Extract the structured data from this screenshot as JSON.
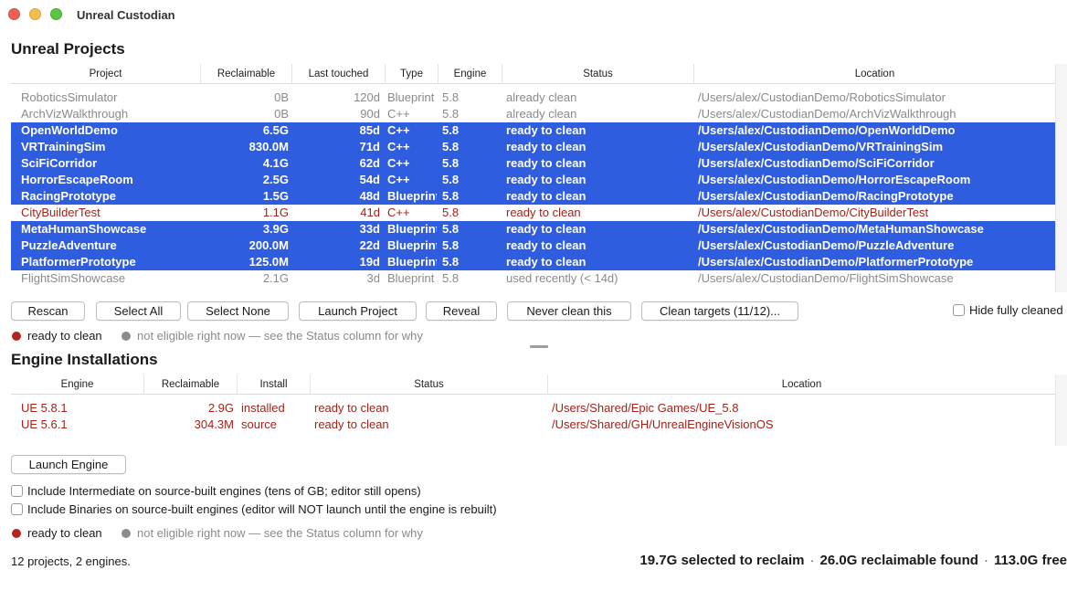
{
  "window": {
    "title": "Unreal Custodian"
  },
  "projects": {
    "title": "Unreal Projects",
    "columns": [
      "Project",
      "Reclaimable",
      "Last touched",
      "Type",
      "Engine",
      "Status",
      "Location"
    ],
    "rows": [
      {
        "name": "RoboticsSimulator",
        "reclaimable": "0B",
        "last": "120d",
        "type": "Blueprint",
        "engine": "5.8",
        "status": "already clean",
        "location": "/Users/alex/CustodianDemo/RoboticsSimulator",
        "state": "gray"
      },
      {
        "name": "ArchVizWalkthrough",
        "reclaimable": "0B",
        "last": "90d",
        "type": "C++",
        "engine": "5.8",
        "status": "already clean",
        "location": "/Users/alex/CustodianDemo/ArchVizWalkthrough",
        "state": "gray"
      },
      {
        "name": "OpenWorldDemo",
        "reclaimable": "6.5G",
        "last": "85d",
        "type": "C++",
        "engine": "5.8",
        "status": "ready to clean",
        "location": "/Users/alex/CustodianDemo/OpenWorldDemo",
        "state": "sel"
      },
      {
        "name": "VRTrainingSim",
        "reclaimable": "830.0M",
        "last": "71d",
        "type": "C++",
        "engine": "5.8",
        "status": "ready to clean",
        "location": "/Users/alex/CustodianDemo/VRTrainingSim",
        "state": "sel"
      },
      {
        "name": "SciFiCorridor",
        "reclaimable": "4.1G",
        "last": "62d",
        "type": "C++",
        "engine": "5.8",
        "status": "ready to clean",
        "location": "/Users/alex/CustodianDemo/SciFiCorridor",
        "state": "sel"
      },
      {
        "name": "HorrorEscapeRoom",
        "reclaimable": "2.5G",
        "last": "54d",
        "type": "C++",
        "engine": "5.8",
        "status": "ready to clean",
        "location": "/Users/alex/CustodianDemo/HorrorEscapeRoom",
        "state": "sel"
      },
      {
        "name": "RacingPrototype",
        "reclaimable": "1.5G",
        "last": "48d",
        "type": "Blueprint",
        "engine": "5.8",
        "status": "ready to clean",
        "location": "/Users/alex/CustodianDemo/RacingPrototype",
        "state": "sel"
      },
      {
        "name": "CityBuilderTest",
        "reclaimable": "1.1G",
        "last": "41d",
        "type": "C++",
        "engine": "5.8",
        "status": "ready to clean",
        "location": "/Users/alex/CustodianDemo/CityBuilderTest",
        "state": "red"
      },
      {
        "name": "MetaHumanShowcase",
        "reclaimable": "3.9G",
        "last": "33d",
        "type": "Blueprint",
        "engine": "5.8",
        "status": "ready to clean",
        "location": "/Users/alex/CustodianDemo/MetaHumanShowcase",
        "state": "sel"
      },
      {
        "name": "PuzzleAdventure",
        "reclaimable": "200.0M",
        "last": "22d",
        "type": "Blueprint",
        "engine": "5.8",
        "status": "ready to clean",
        "location": "/Users/alex/CustodianDemo/PuzzleAdventure",
        "state": "sel"
      },
      {
        "name": "PlatformerPrototype",
        "reclaimable": "125.0M",
        "last": "19d",
        "type": "Blueprint",
        "engine": "5.8",
        "status": "ready to clean",
        "location": "/Users/alex/CustodianDemo/PlatformerPrototype",
        "state": "sel"
      },
      {
        "name": "FlightSimShowcase",
        "reclaimable": "2.1G",
        "last": "3d",
        "type": "Blueprint",
        "engine": "5.8",
        "status": "used recently (< 14d)",
        "location": "/Users/alex/CustodianDemo/FlightSimShowcase",
        "state": "gray"
      }
    ],
    "buttons": {
      "rescan": "Rescan",
      "select_all": "Select All",
      "select_none": "Select None",
      "launch_project": "Launch Project",
      "reveal": "Reveal",
      "never_clean": "Never clean this",
      "clean_targets": "Clean targets (11/12)..."
    },
    "hide_fully_cleaned": "Hide fully cleaned"
  },
  "legend": {
    "ready": "ready to clean",
    "not_eligible": "not eligible right now — see the Status column for why"
  },
  "engines": {
    "title": "Engine Installations",
    "columns": [
      "Engine",
      "Reclaimable",
      "Install",
      "Status",
      "Location"
    ],
    "rows": [
      {
        "engine": "UE 5.8.1",
        "reclaimable": "2.9G",
        "install": "installed",
        "status": "ready to clean",
        "location": "/Users/Shared/Epic Games/UE_5.8"
      },
      {
        "engine": "UE 5.6.1",
        "reclaimable": "304.3M",
        "install": "source",
        "status": "ready to clean",
        "location": "/Users/Shared/GH/UnrealEngineVisionOS"
      }
    ],
    "launch_engine": "Launch Engine",
    "include_intermediate": "Include Intermediate on source-built engines (tens of GB; editor still opens)",
    "include_binaries": "Include Binaries on source-built engines (editor will NOT launch until the engine is rebuilt)"
  },
  "footer": {
    "summary": "12 projects, 2 engines.",
    "selected": "19.7G selected to reclaim",
    "found": "26.0G reclaimable found",
    "free": "113.0G free",
    "separator": "·"
  },
  "colors": {
    "selection": "#2f5de0",
    "ready_red": "#a3231b",
    "muted_gray": "#8a8a8a"
  }
}
